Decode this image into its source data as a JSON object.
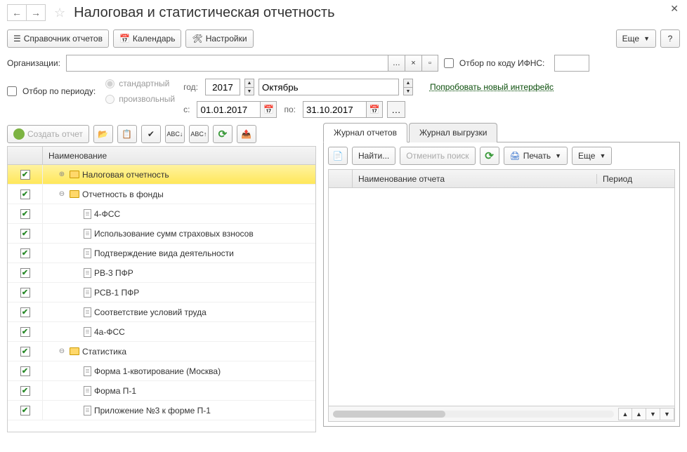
{
  "page_title": "Налоговая и статистическая отчетность",
  "toolbar": {
    "reports_dir": "Справочник отчетов",
    "calendar": "Календарь",
    "settings": "Настройки",
    "more": "Еще"
  },
  "org": {
    "label": "Организации:",
    "value": "",
    "filter_ifns_label": "Отбор по коду ИФНС:",
    "ifns_value": ""
  },
  "period": {
    "filter_label": "Отбор по периоду:",
    "radio_standard": "стандартный",
    "radio_custom": "произвольный",
    "year_label": "год:",
    "year_value": "2017",
    "month_value": "Октябрь",
    "from_label": "с:",
    "from_value": "01.01.2017",
    "to_label": "по:",
    "to_value": "31.10.2017",
    "link_new": "Попробовать новый интерфейс"
  },
  "left_toolbar": {
    "create": "Создать отчет"
  },
  "tree": {
    "header_name": "Наименование",
    "rows": [
      {
        "label": "Налоговая отчетность"
      },
      {
        "label": "Отчетность в фонды"
      },
      {
        "label": "4-ФСС"
      },
      {
        "label": "Использование сумм страховых взносов"
      },
      {
        "label": "Подтверждение вида деятельности"
      },
      {
        "label": "РВ-3 ПФР"
      },
      {
        "label": "РСВ-1 ПФР"
      },
      {
        "label": "Соответствие условий труда"
      },
      {
        "label": "4а-ФСС"
      },
      {
        "label": "Статистика"
      },
      {
        "label": "Форма 1-квотирование (Москва)"
      },
      {
        "label": "Форма П-1"
      },
      {
        "label": "Приложение №3 к форме П-1"
      }
    ]
  },
  "tabs": {
    "reports": "Журнал отчетов",
    "upload": "Журнал выгрузки"
  },
  "right_toolbar": {
    "find": "Найти...",
    "cancel_find": "Отменить поиск",
    "print": "Печать",
    "more": "Еще"
  },
  "grid": {
    "col_name": "Наименование отчета",
    "col_period": "Период"
  }
}
